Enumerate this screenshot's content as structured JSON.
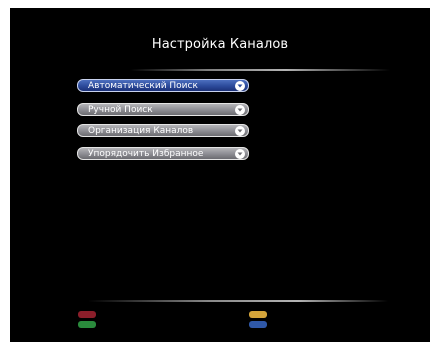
{
  "screen": {
    "title": "Настройка Каналов"
  },
  "menu": {
    "items": [
      {
        "label": "Автоматический Поиск",
        "state": "selected"
      },
      {
        "label": "Ручной Поиск",
        "state": "normal"
      },
      {
        "label": "Организация Каналов",
        "state": "normal"
      },
      {
        "label": "Упорядочить Избранное",
        "state": "normal"
      }
    ],
    "arrow_icon": "chevron-down-icon"
  },
  "colors": {
    "background": "#000000",
    "selected_item": "#2c4a9b",
    "normal_item": "#8c8c92",
    "red_key": "#8b1e2a",
    "green_key": "#2a8a3c",
    "yellow_key": "#d4a43a",
    "blue_key": "#2f58a8"
  }
}
